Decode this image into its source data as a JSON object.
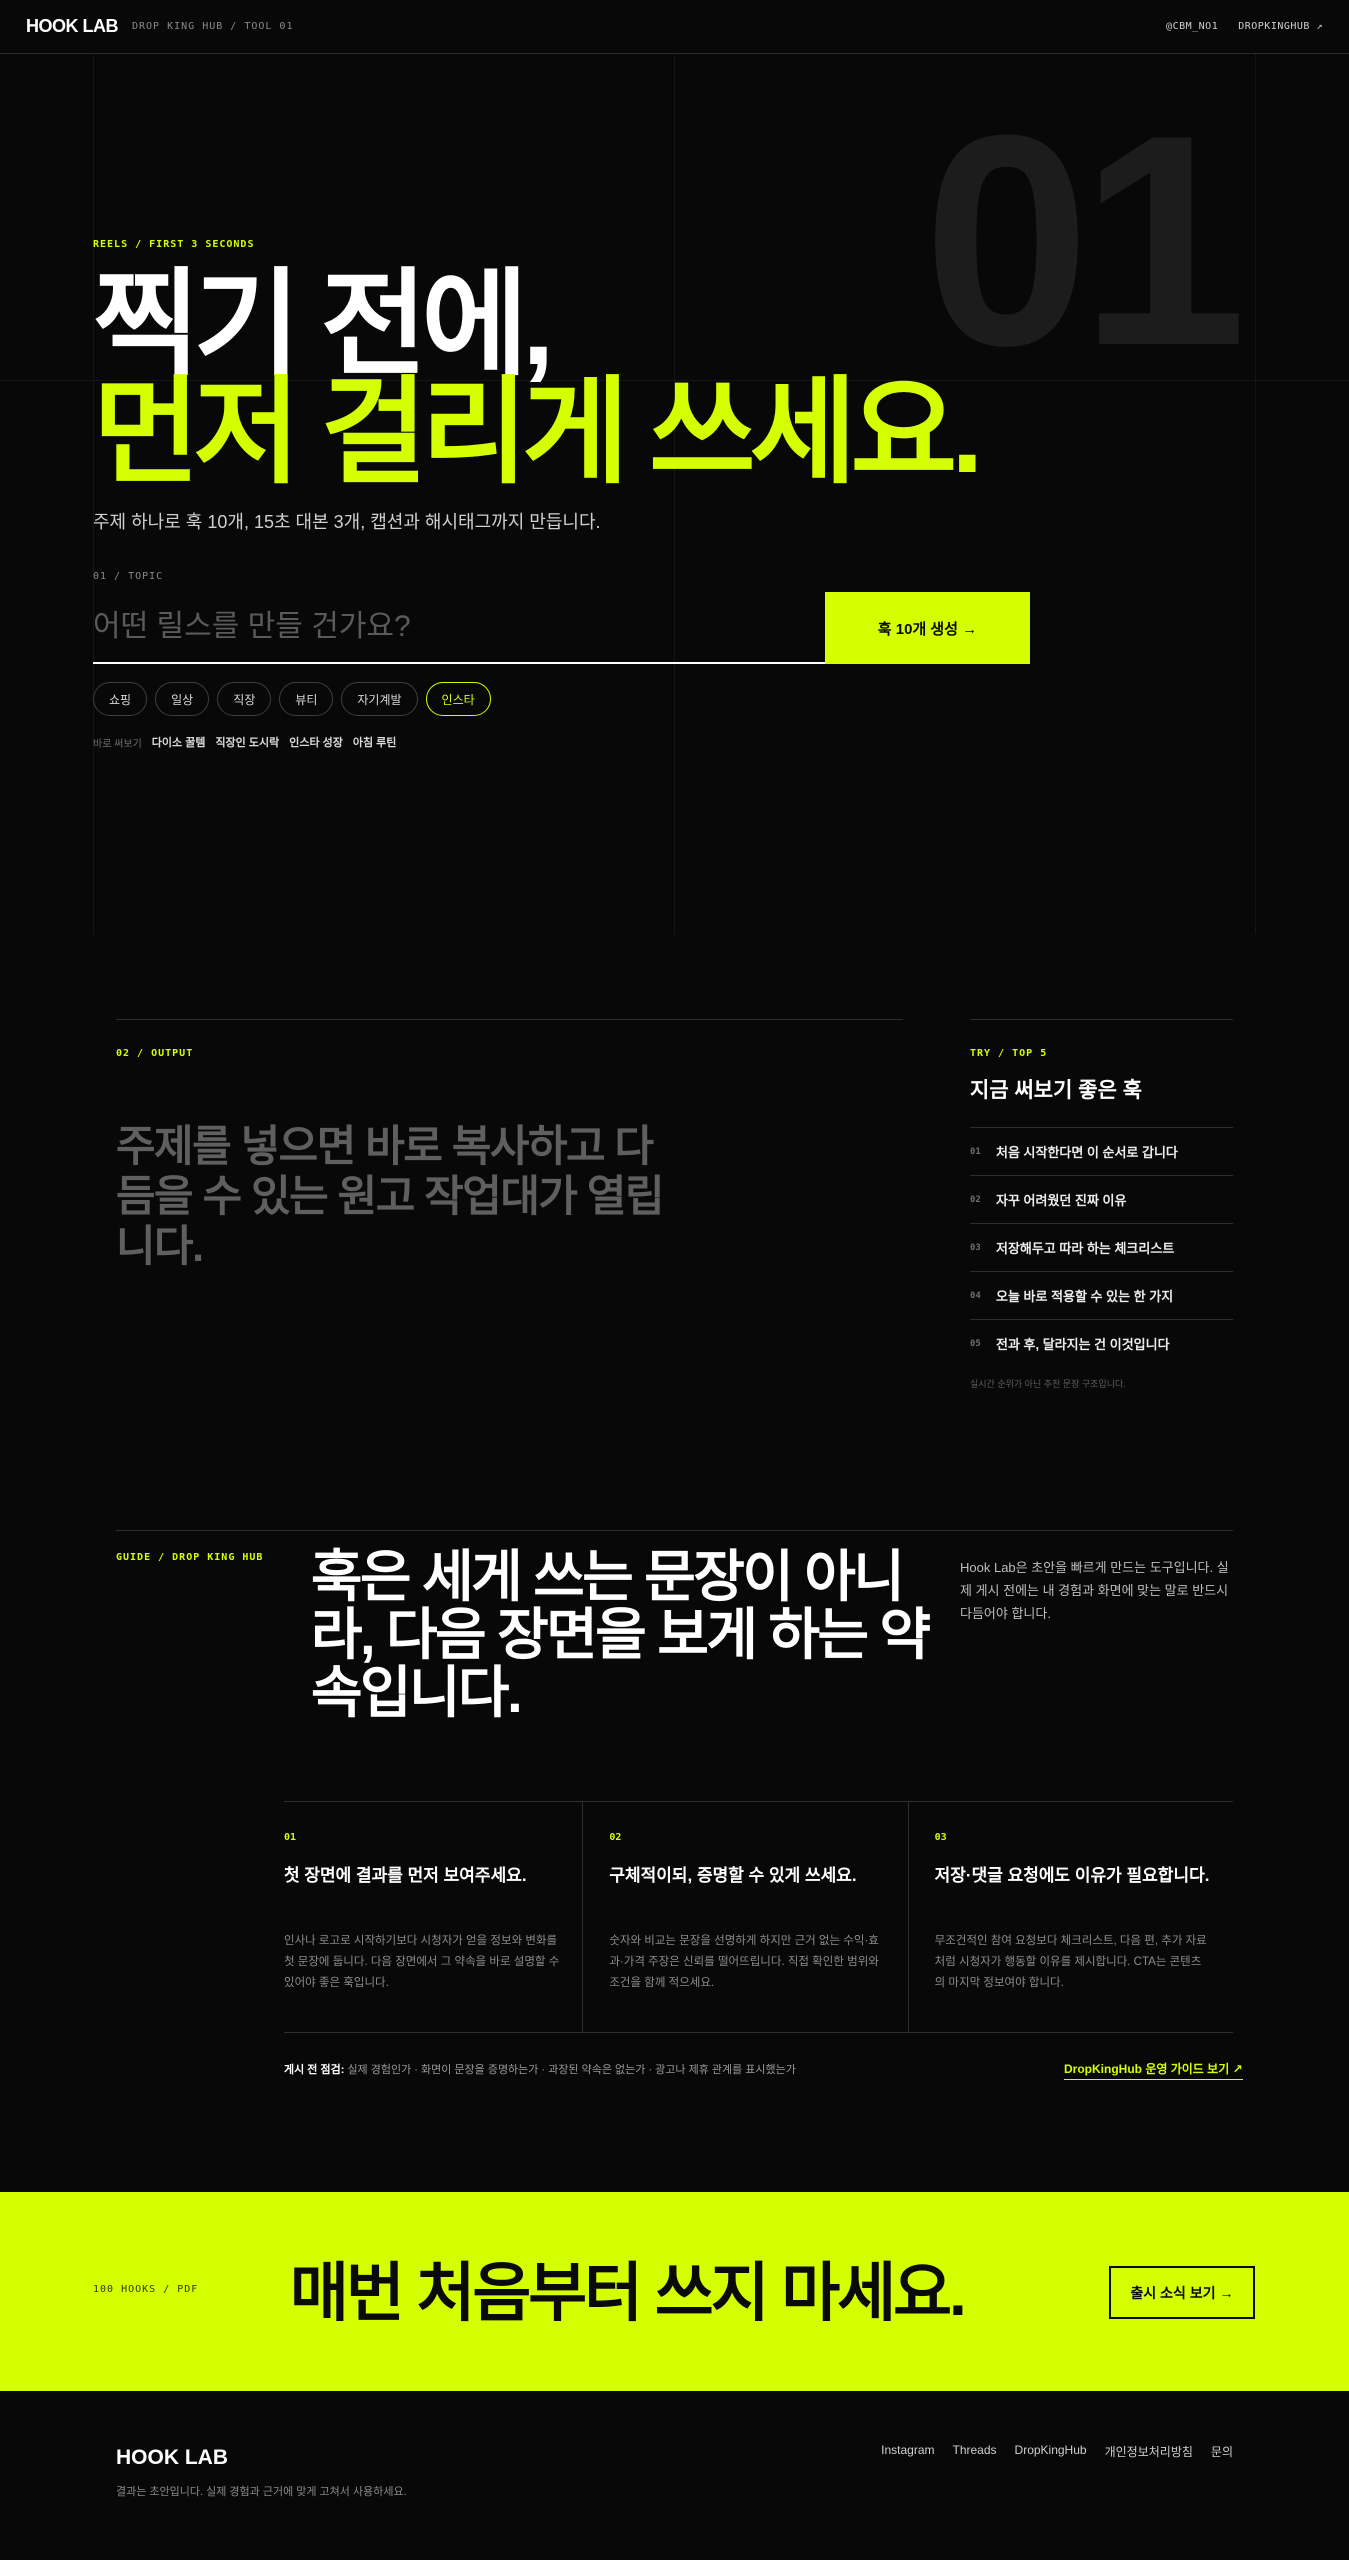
{
  "topbar": {
    "brand": "HOOK LAB",
    "crumb": "DROP KING HUB / TOOL 01",
    "handle": "@CBM_NO1",
    "link": "DROPKINGHUB ↗"
  },
  "hero": {
    "big_number": "01",
    "kicker": "REELS / FIRST 3 SECONDS",
    "title_line1": "찍기 전에,",
    "title_line2": "먼저 걸리게 쓰세요.",
    "subtitle": "주제 하나로 훅 10개, 15초 대본 3개, 캡션과 해시태그까지 만듭니다.",
    "topic_label": "01 / TOPIC",
    "topic_placeholder": "어떤 릴스를 만들 건가요?",
    "generate_label": "훅 10개 생성 →",
    "chips": [
      "쇼핑",
      "일상",
      "직장",
      "뷰티",
      "자기계발",
      "인스타"
    ],
    "active_chip": "인스타",
    "quick_label": "바로 써보기",
    "quick_items": [
      "다이소 꿀템",
      "직장인 도시락",
      "인스타 성장",
      "아침 루틴"
    ]
  },
  "output": {
    "kicker": "02 / OUTPUT",
    "text": "주제를 넣으면 바로 복사하고 다듬을 수 있는 원고 작업대가 열립니다."
  },
  "try": {
    "kicker": "TRY / TOP 5",
    "title": "지금 써보기 좋은 훅",
    "items": [
      {
        "num": "01",
        "text": "처음 시작한다면 이 순서로 갑니다"
      },
      {
        "num": "02",
        "text": "자꾸 어려웠던 진짜 이유"
      },
      {
        "num": "03",
        "text": "저장해두고 따라 하는 체크리스트"
      },
      {
        "num": "04",
        "text": "오늘 바로 적용할 수 있는 한 가지"
      },
      {
        "num": "05",
        "text": "전과 후, 달라지는 건 이것입니다"
      }
    ],
    "note": "실시간 순위가 아닌 추천 문장 구조입니다."
  },
  "guide": {
    "kicker": "GUIDE / DROP KING HUB",
    "title": "훅은 세게 쓰는 문장이 아니라, 다음 장면을 보게 하는 약속입니다.",
    "description": "Hook Lab은 초안을 빠르게 만드는 도구입니다. 실제 게시 전에는 내 경험과 화면에 맞는 말로 반드시 다듬어야 합니다.",
    "cards": [
      {
        "num": "01",
        "title": "첫 장면에 결과를 먼저 보여주세요.",
        "body": "인사나 로고로 시작하기보다 시청자가 얻을 정보와 변화를 첫 문장에 둡니다. 다음 장면에서 그 약속을 바로 설명할 수 있어야 좋은 훅입니다."
      },
      {
        "num": "02",
        "title": "구체적이되, 증명할 수 있게 쓰세요.",
        "body": "숫자와 비교는 문장을 선명하게 하지만 근거 없는 수익·효과·가격 주장은 신뢰를 떨어뜨립니다. 직접 확인한 범위와 조건을 함께 적으세요."
      },
      {
        "num": "03",
        "title": "저장·댓글 요청에도 이유가 필요합니다.",
        "body": "무조건적인 참여 요청보다 체크리스트, 다음 편, 추가 자료처럼 시청자가 행동할 이유를 제시합니다. CTA는 콘텐츠의 마지막 정보여야 합니다."
      }
    ],
    "checklist_label": "게시 전 점검:",
    "checklist_text": "실제 경험인가 · 화면이 문장을 증명하는가 · 과장된 약속은 없는가 · 광고나 제휴 관계를 표시했는가",
    "link": "DropKingHub 운영 가이드 보기 ↗"
  },
  "cta": {
    "kicker": "100 HOOKS / PDF",
    "title": "매번 처음부터 쓰지 마세요.",
    "button": "출시 소식 보기 →"
  },
  "footer": {
    "brand": "HOOK LAB",
    "note": "결과는 초안입니다. 실제 경험과 근거에 맞게 고쳐서 사용하세요.",
    "links": [
      "Instagram",
      "Threads",
      "DropKingHub",
      "개인정보처리방침",
      "문의"
    ]
  },
  "colors": {
    "background": "#080808",
    "accent": "#d4ff00",
    "muted_text": "#8a8a8a"
  }
}
